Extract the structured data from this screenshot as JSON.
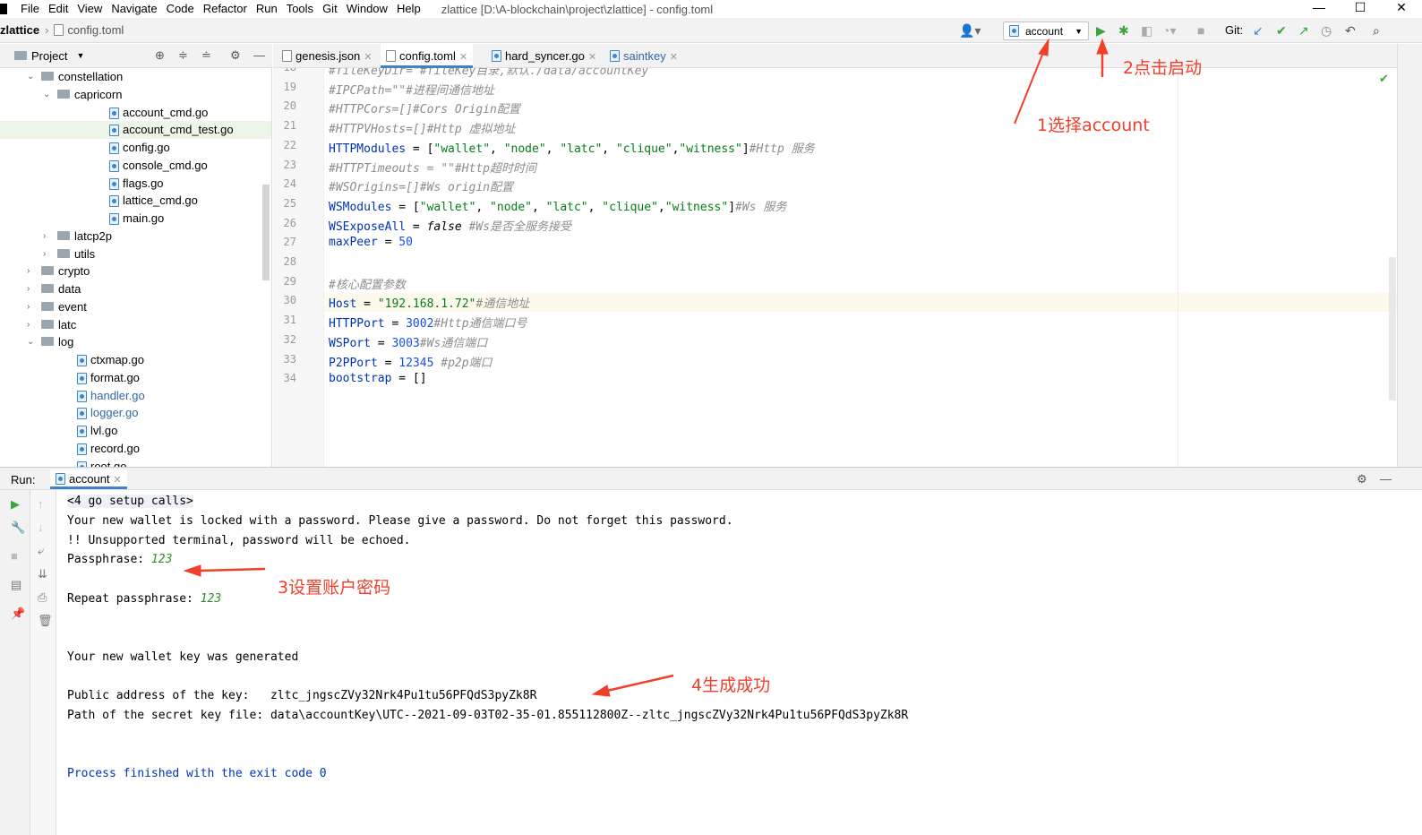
{
  "menubar": {
    "items": [
      "File",
      "Edit",
      "View",
      "Navigate",
      "Code",
      "Refactor",
      "Run",
      "Tools",
      "Git",
      "Window",
      "Help"
    ],
    "window_title": "zlattice [D:\\A-blockchain\\project\\zlattice] - config.toml",
    "controls": [
      "—",
      "☐",
      "✕"
    ]
  },
  "navbar": {
    "project": "zlattice",
    "file": "config.toml",
    "run_config": "account",
    "git_label": "Git:"
  },
  "project_panel": {
    "title": "Project",
    "tree": [
      {
        "label": "constellation",
        "type": "folder",
        "expanded": true
      },
      {
        "label": "capricorn",
        "type": "folder",
        "expanded": true
      },
      {
        "label": "account_cmd.go",
        "type": "go"
      },
      {
        "label": "account_cmd_test.go",
        "type": "go",
        "selected": true
      },
      {
        "label": "config.go",
        "type": "go"
      },
      {
        "label": "console_cmd.go",
        "type": "go"
      },
      {
        "label": "flags.go",
        "type": "go"
      },
      {
        "label": "lattice_cmd.go",
        "type": "go"
      },
      {
        "label": "main.go",
        "type": "go"
      },
      {
        "label": "latcp2p",
        "type": "folder",
        "expanded": false
      },
      {
        "label": "utils",
        "type": "folder",
        "expanded": false
      },
      {
        "label": "crypto",
        "type": "folder",
        "expanded": false
      },
      {
        "label": "data",
        "type": "folder",
        "expanded": false
      },
      {
        "label": "event",
        "type": "folder",
        "expanded": false
      },
      {
        "label": "latc",
        "type": "folder",
        "expanded": false
      },
      {
        "label": "log",
        "type": "folder",
        "expanded": true
      },
      {
        "label": "ctxmap.go",
        "type": "go"
      },
      {
        "label": "format.go",
        "type": "go"
      },
      {
        "label": "handler.go",
        "type": "go",
        "modified": true
      },
      {
        "label": "logger.go",
        "type": "go",
        "modified": true
      },
      {
        "label": "lvl.go",
        "type": "go"
      },
      {
        "label": "record.go",
        "type": "go"
      },
      {
        "label": "root.go",
        "type": "go"
      }
    ]
  },
  "tabs": [
    {
      "label": "genesis.json"
    },
    {
      "label": "config.toml",
      "active": true
    },
    {
      "label": "hard_syncer.go"
    },
    {
      "label": "saintkey"
    }
  ],
  "editor": {
    "lines": [
      {
        "n": "18",
        "text": "#fileKeyDir=\"#fileKey目录,默认./data/accountKey"
      },
      {
        "n": "19",
        "text": "#IPCPath=\"\"#进程间通信地址"
      },
      {
        "n": "20",
        "text": "#HTTPCors=[]#Cors Origin配置"
      },
      {
        "n": "21",
        "text": "#HTTPVHosts=[]#Http 虚拟地址"
      },
      {
        "n": "22",
        "text": "HTTPModules = [\"wallet\", \"node\", \"latc\", \"clique\",\"witness\"]#Http 服务"
      },
      {
        "n": "23",
        "text": "#HTTPTimeouts = \"\"#Http超时时间"
      },
      {
        "n": "24",
        "text": "#WSOrigins=[]#Ws origin配置"
      },
      {
        "n": "25",
        "text": "WSModules = [\"wallet\", \"node\", \"latc\", \"clique\",\"witness\"]#Ws 服务"
      },
      {
        "n": "26",
        "text": "WSExposeAll = false #Ws是否全服务接受"
      },
      {
        "n": "27",
        "text": "maxPeer = 50"
      },
      {
        "n": "28",
        "text": ""
      },
      {
        "n": "29",
        "text": "#核心配置参数"
      },
      {
        "n": "30",
        "text": "Host = \"192.168.1.72\"#通信地址"
      },
      {
        "n": "31",
        "text": "HTTPPort = 3002#Http通信端口号"
      },
      {
        "n": "32",
        "text": "WSPort = 3003#Ws通信端口"
      },
      {
        "n": "33",
        "text": "P2PPort = 12345 #p2p端口"
      },
      {
        "n": "34",
        "text": "bootstrap = []"
      }
    ]
  },
  "run_panel": {
    "label": "Run:",
    "tab": "account",
    "console": {
      "setup": "<4 go setup calls>",
      "line1": "Your new wallet is locked with a password. Please give a password. Do not forget this password.",
      "line2": "!! Unsupported terminal, password will be echoed.",
      "pass_label": "Passphrase: ",
      "pass_value": "123",
      "repeat_label": "Repeat passphrase: ",
      "repeat_value": "123",
      "generated": "Your new wallet key was generated",
      "public_label": "Public address of the key:   ",
      "public_value": "zltc_jngscZVy32Nrk4Pu1tu56PFQdS3pyZk8R",
      "path_label": "Path of the secret key file: ",
      "path_value": "data\\accountKey\\UTC--2021-09-03T02-35-01.855112800Z--zltc_jngscZVy32Nrk4Pu1tu56PFQdS3pyZk8R",
      "finished": "Process finished with the exit code 0"
    }
  },
  "annotations": {
    "a1": "1选择account",
    "a2": "2点击启动",
    "a3": "3设置账户密码",
    "a4": "4生成成功",
    "color": "#f23f2b"
  }
}
